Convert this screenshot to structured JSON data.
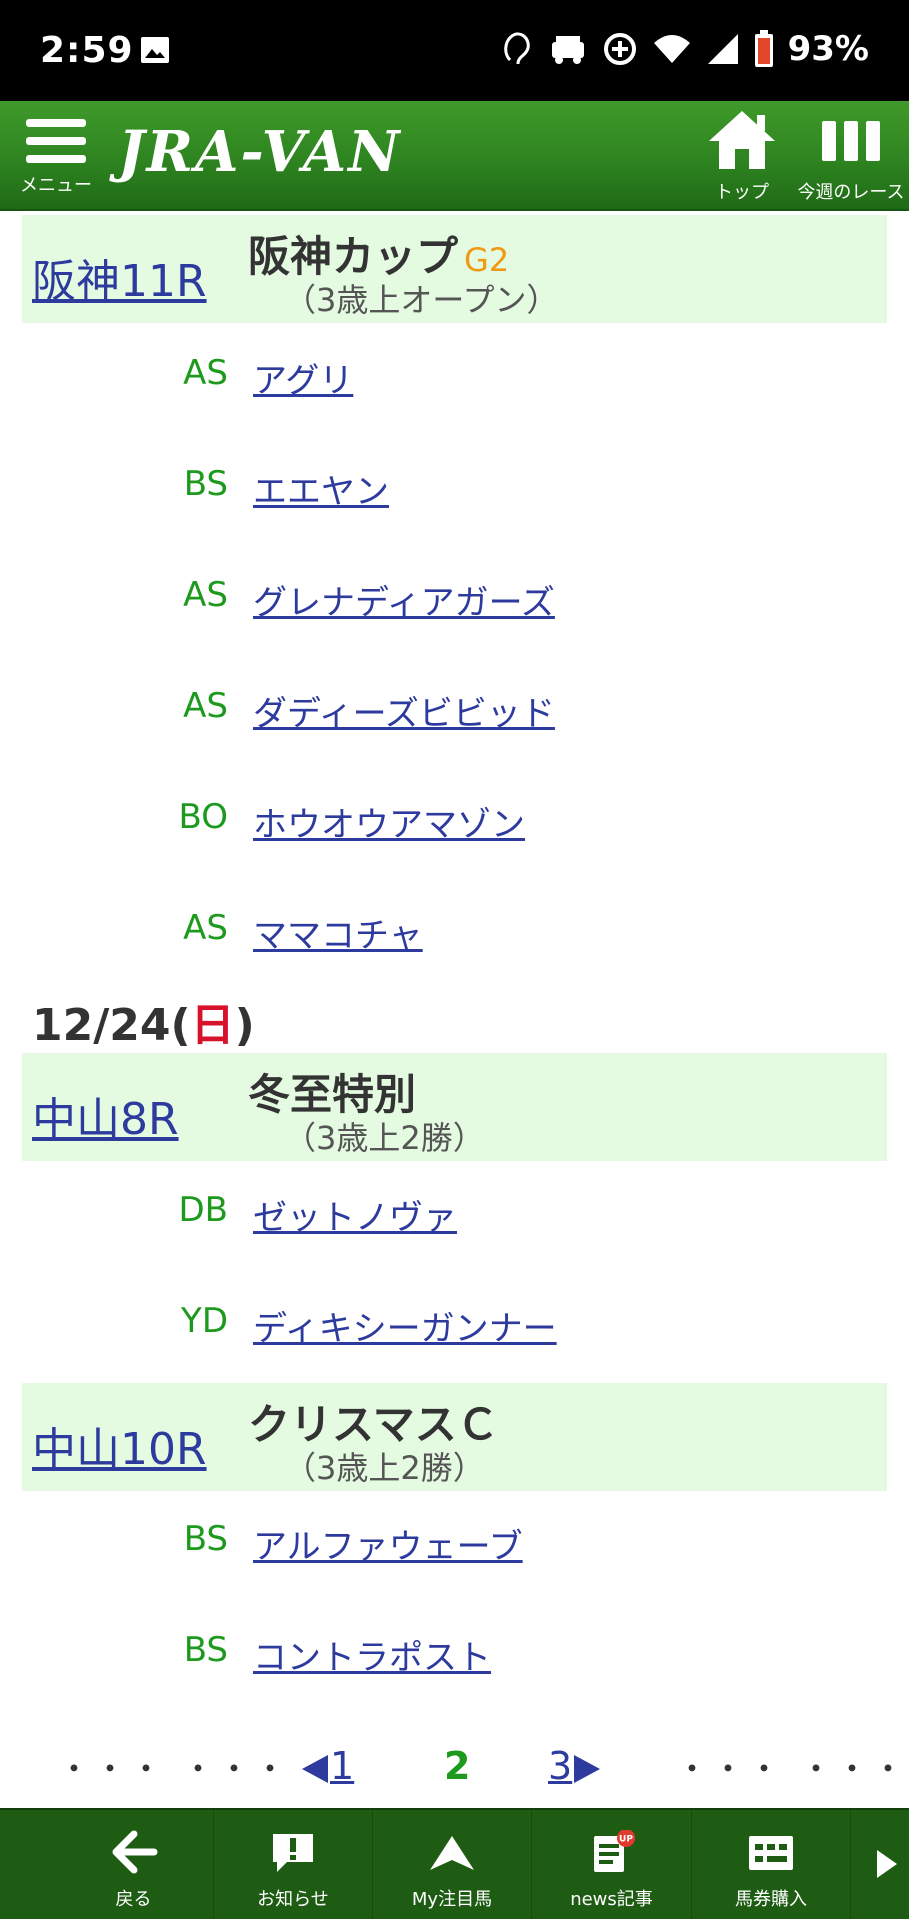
{
  "status_bar": {
    "time": "2:59",
    "battery": "93%"
  },
  "header": {
    "menu_label": "メニュー",
    "logo_text": "JRA-VAN",
    "top_label": "トップ",
    "week_label": "今週のレース"
  },
  "races_day1": [
    {
      "venue_race": "阪神11R",
      "title": "阪神カップ",
      "grade": "G2",
      "condition": "（3歳上オープン）",
      "horses": [
        {
          "code": "AS",
          "name": "アグリ"
        },
        {
          "code": "BS",
          "name": "エエヤン"
        },
        {
          "code": "AS",
          "name": "グレナディアガーズ"
        },
        {
          "code": "AS",
          "name": "ダディーズビビッド"
        },
        {
          "code": "BO",
          "name": "ホウオウアマゾン"
        },
        {
          "code": "AS",
          "name": "ママコチャ"
        }
      ]
    }
  ],
  "date2": {
    "date": "12/24(",
    "dow": "日",
    "close": ")"
  },
  "races_day2": [
    {
      "venue_race": "中山8R",
      "title": "冬至特別",
      "condition": "（3歳上2勝）",
      "horses": [
        {
          "code": "DB",
          "name": "ゼットノヴァ"
        },
        {
          "code": "YD",
          "name": "ディキシーガンナー"
        }
      ]
    },
    {
      "venue_race": "中山10R",
      "title": "クリスマスＣ",
      "condition": "（3歳上2勝）",
      "horses": [
        {
          "code": "BS",
          "name": "アルファウェーブ"
        },
        {
          "code": "BS",
          "name": "コントラポスト"
        }
      ]
    }
  ],
  "pager": {
    "dots": "・・・",
    "prev": "1",
    "current": "2",
    "next": "3"
  },
  "bottom_bar": [
    {
      "label": "戻る",
      "icon": "back-arrow-icon"
    },
    {
      "label": "お知らせ",
      "icon": "notice-icon"
    },
    {
      "label": "My注目馬",
      "icon": "my-horse-icon"
    },
    {
      "label": "news記事",
      "icon": "news-icon",
      "badge": "UP"
    },
    {
      "label": "馬券購入",
      "icon": "ticket-icon"
    }
  ],
  "colors": {
    "header_green": "#2e8420",
    "race_bg": "#e4fbe2",
    "link_blue": "#2d3a9e",
    "code_green": "#1d9a1d",
    "grade_orange": "#ef9a12",
    "sunday_red": "#d6132b"
  }
}
